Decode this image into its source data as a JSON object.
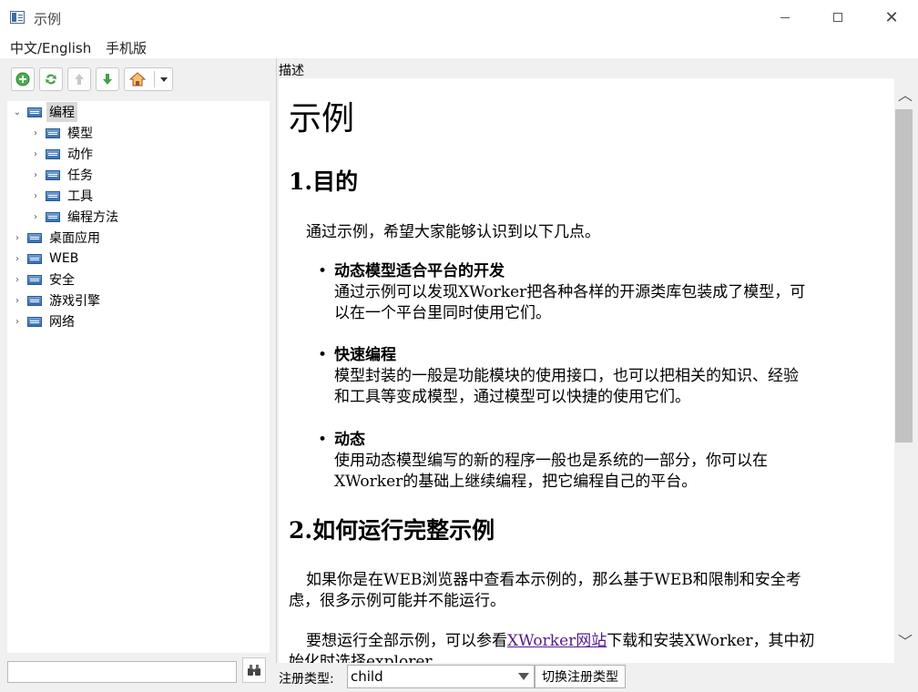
{
  "window": {
    "title": "示例"
  },
  "menu": {
    "lang": "中文/English",
    "mobile": "手机版"
  },
  "tree": {
    "root": "编程",
    "children": [
      "模型",
      "动作",
      "任务",
      "工具",
      "编程方法"
    ],
    "siblings": [
      "桌面应用",
      "WEB",
      "安全",
      "游戏引擎",
      "网络"
    ]
  },
  "desc_label": "描述",
  "doc": {
    "title": "示例",
    "h_purpose": "1.目的",
    "intro": "通过示例，希望大家能够认识到以下几点。",
    "bullets": [
      {
        "title": "动态模型适合平台的开发",
        "line1": "通过示例可以发现XWorker把各种各样的开源类库包装成了模型，可",
        "line2": "以在一个平台里同时使用它们。"
      },
      {
        "title": "快速编程",
        "line1": "模型封装的一般是功能模块的使用接口，也可以把相关的知识、经验",
        "line2": "和工具等变成模型，通过模型可以快捷的使用它们。"
      },
      {
        "title": "动态",
        "line1": "使用动态模型编写的新的程序一般也是系统的一部分，你可以在",
        "line2": "XWorker的基础上继续编程，把它编程自己的平台。"
      }
    ],
    "h_run": "2.如何运行完整示例",
    "run_p1_line1": "如果你是在WEB浏览器中查看本示例的，那么基于WEB和限制和安全考",
    "run_p1_line2": "虑，很多示例可能并不能运行。",
    "run_p2_pre": "要想运行全部示例，可以参看",
    "run_p2_link": "XWorker网站",
    "run_p2_post": "下载和安装XWorker，其中初",
    "run_p2_line2": "始化时选择explorer。"
  },
  "bottom": {
    "reg_label": "注册类型:",
    "reg_value": "child",
    "switch_btn": "切换注册类型"
  }
}
